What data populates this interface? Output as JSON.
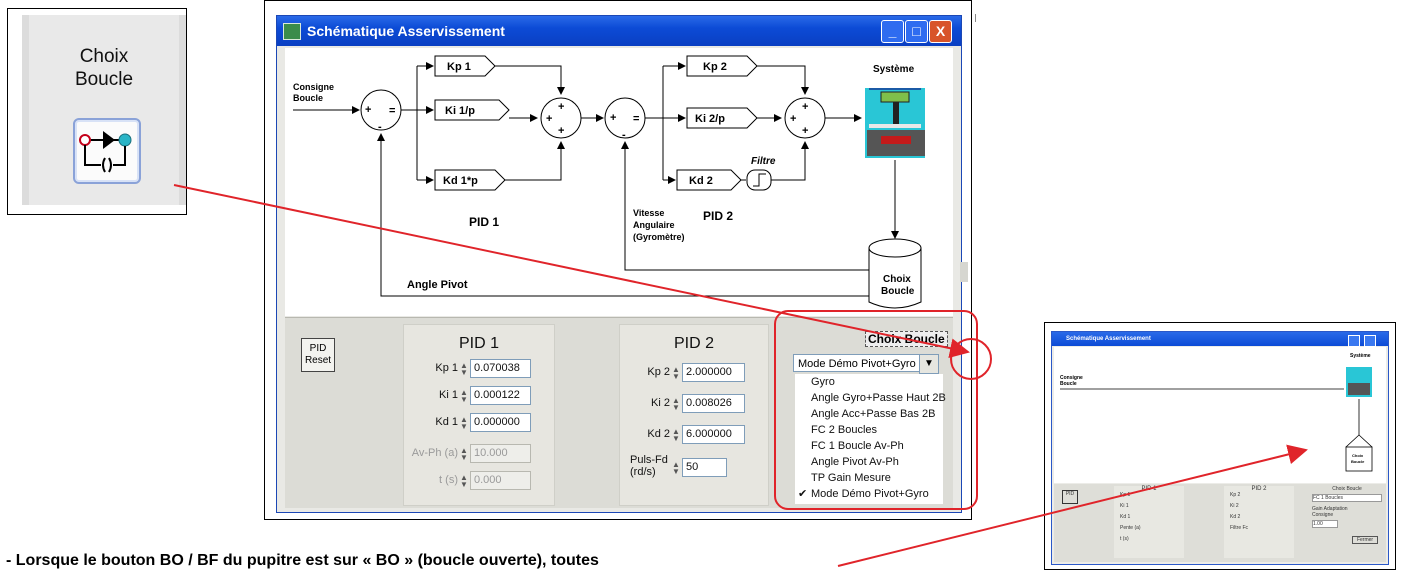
{
  "zoom": {
    "line1": "Choix",
    "line2": "Boucle"
  },
  "window": {
    "title": "Schématique Asservissement",
    "controls": {
      "min": "_",
      "max": "□",
      "close": "X"
    }
  },
  "diagram": {
    "consigne": "Consigne",
    "boucle": "Boucle",
    "kp1": "Kp 1",
    "ki1": "Ki 1/p",
    "kd1": "Kd 1*p",
    "kp2": "Kp 2",
    "ki2": "Ki 2/p",
    "kd2": "Kd 2",
    "filtre": "Filtre",
    "systeme": "Système",
    "pid1": "PID 1",
    "pid2": "PID 2",
    "vitesse1": "Vitesse",
    "vitesse2": "Angulaire",
    "vitesse3": "(Gyromètre)",
    "angle_pivot": "Angle Pivot",
    "choix1": "Choix",
    "choix2": "Boucle",
    "plus": "+",
    "minus": "-",
    "equals": "="
  },
  "controls": {
    "reset": {
      "line1": "PID",
      "line2": "Reset"
    },
    "pid1": {
      "title": "PID 1",
      "rows": [
        {
          "label": "Kp 1",
          "value": "0.070038",
          "disabled": false
        },
        {
          "label": "Ki 1",
          "value": "0.000122",
          "disabled": false
        },
        {
          "label": "Kd 1",
          "value": "0.000000",
          "disabled": false
        },
        {
          "label": "Av-Ph (a)",
          "value": "10.000",
          "disabled": true
        },
        {
          "label": "t (s)",
          "value": "0.000",
          "disabled": true
        }
      ]
    },
    "pid2": {
      "title": "PID 2",
      "rows": [
        {
          "label": "Kp 2",
          "value": "2.000000"
        },
        {
          "label": "Ki 2",
          "value": "0.008026"
        },
        {
          "label": "Kd 2",
          "value": "6.000000"
        }
      ],
      "puls_label1": "Puls-Fd",
      "puls_label2": "(rd/s)",
      "puls_value": "50"
    },
    "choix": {
      "title": "Choix Boucle",
      "selected": "Mode Démo Pivot+Gyro",
      "options": [
        "Gyro",
        "Angle Gyro+Passe Haut 2B",
        "Angle Acc+Passe Bas 2B",
        "FC 2 Boucles",
        "FC 1 Boucle Av-Ph",
        "Angle Pivot Av-Ph",
        "TP Gain Mesure",
        "Mode Démo Pivot+Gyro"
      ],
      "checked_mark": "✔"
    }
  },
  "small": {
    "title": "Schématique Asservissement",
    "systeme": "Système",
    "consigne": "Consigne",
    "boucle": "Boucle",
    "choix1": "Choix",
    "choix2": "Boucle",
    "pid1": "PID 1",
    "pid2": "PID 2",
    "choix_title": "Choix Boucle",
    "choix_value": "FC 1 Boucles",
    "gain1": "Gain Adaptation",
    "gain2": "Consigne",
    "gain_value": "1.00",
    "reset1": "PID",
    "reset2": "Reset",
    "fermer": "Fermer",
    "rows1": [
      "Kp 1",
      "Ki 1",
      "Kd 1",
      "Pente (a)",
      "t (s)"
    ],
    "rows2": [
      "Kp 2",
      "Ki 2",
      "Kd 2",
      "Filtre Fc"
    ]
  },
  "caption": "- Lorsque le bouton BO / BF du pupitre est sur « BO » (boucle ouverte), toutes",
  "colors": {
    "accent_red": "#e0242a",
    "titlebar": "#0c4bd6",
    "cyan": "#29b4c6"
  }
}
